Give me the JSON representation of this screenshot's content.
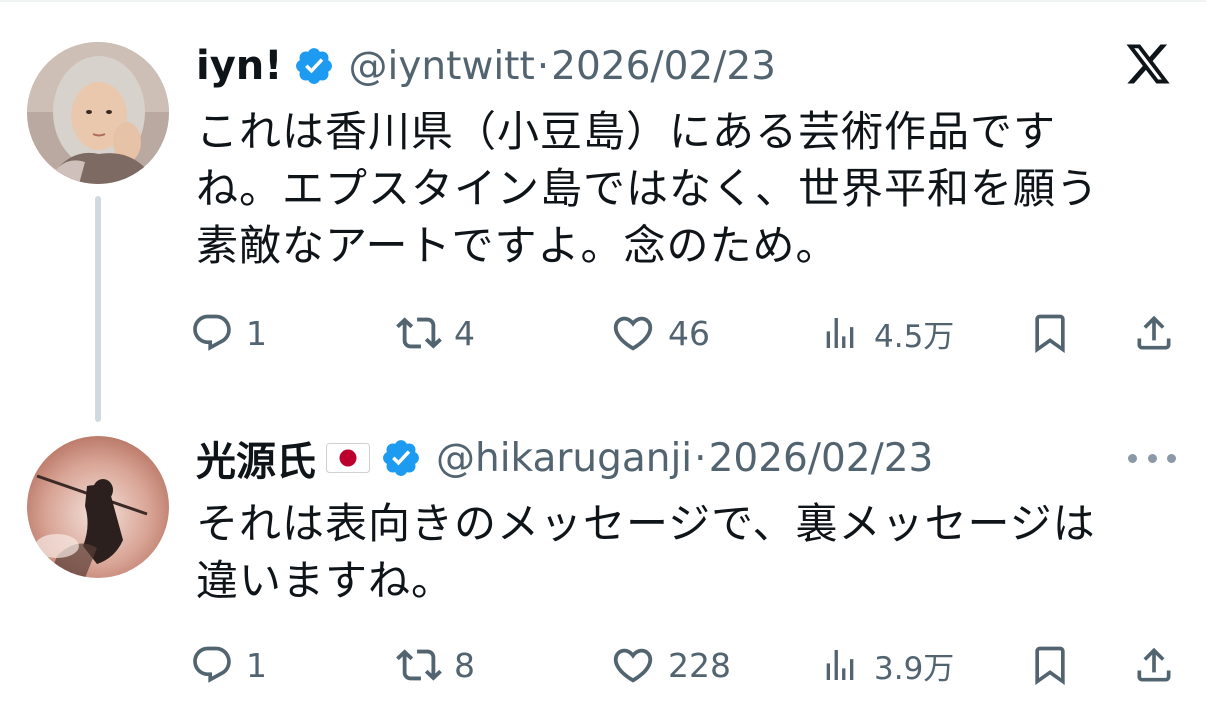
{
  "brand": {
    "logo": "x-logo",
    "accent": "#1d9bf0",
    "secondary_text": "#536471"
  },
  "tweets": [
    {
      "display_name": "iyn!",
      "handle": "@iyntwitt",
      "separator": "·",
      "date": "2026/02/23",
      "verified": true,
      "text_lines": [
        "これは香川県（小豆島）にある芸術作品です",
        "ね。エプスタイン島ではなく、世界平和を願う",
        "素敵なアートですよ。念のため。"
      ],
      "actions": {
        "replies": "1",
        "retweets": "4",
        "likes": "46",
        "views": "4.5万"
      }
    },
    {
      "display_name": "光源氏",
      "flag": "japan-flag-emoji",
      "handle": "@hikaruganji",
      "separator": "·",
      "date": "2026/02/23",
      "verified": true,
      "text_lines": [
        "それは表向きのメッセージで、裏メッセージは",
        "違いますね。"
      ],
      "actions": {
        "replies": "1",
        "retweets": "8",
        "likes": "228",
        "views": "3.9万"
      }
    }
  ]
}
